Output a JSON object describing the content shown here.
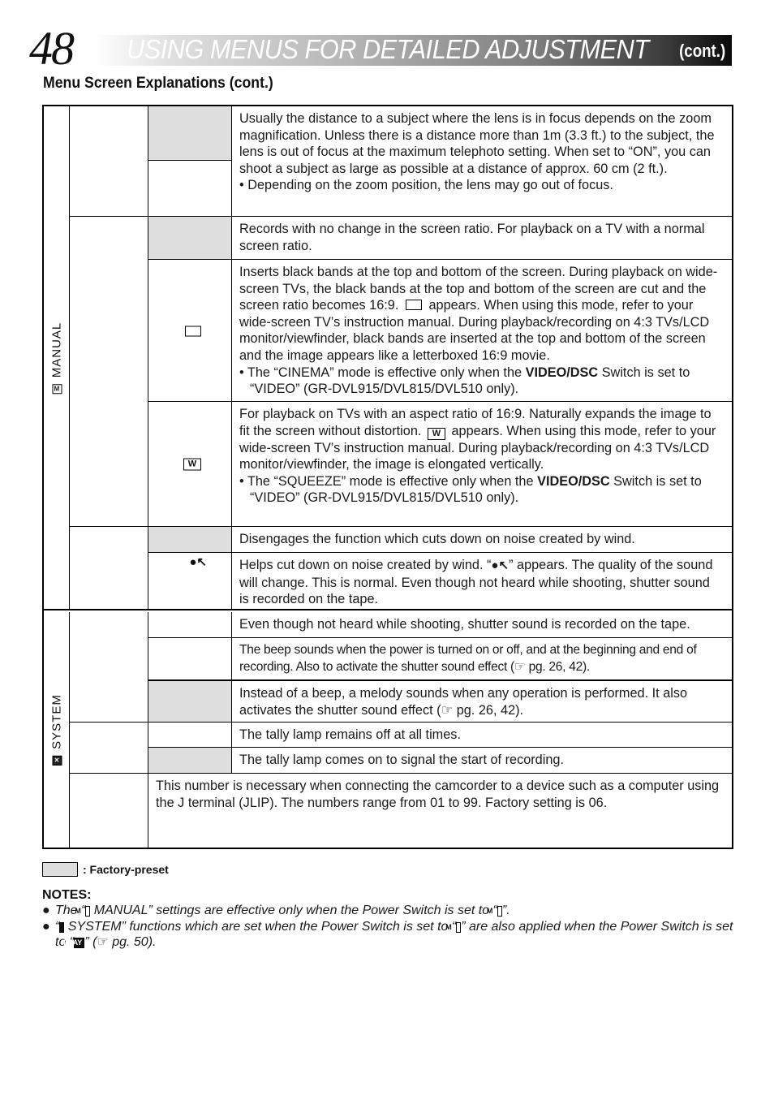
{
  "header": {
    "page_number": "48",
    "title": "USING MENUS FOR DETAILED ADJUSTMENT",
    "cont": "(cont.)"
  },
  "section_title": "Menu Screen Explanations (cont.)",
  "groups": {
    "manual": {
      "label": "MANUAL",
      "icon": "M",
      "rows": {
        "tele_macro": {
          "desc": "Usually the distance to a subject where the lens is in focus depends on the zoom magnification. Unless there is a distance more than 1m (3.3 ft.) to the subject, the lens is out of focus at the maximum telephoto setting. When set to “ON”, you can shoot a subject as large as possible at a distance of approx. 60 cm (2 ft.).",
          "bullet": "• Depending on the zoom position, the lens may go out of focus."
        },
        "wide_normal": {
          "desc": "Records with no change in the screen ratio. For playback on a TV with a normal screen ratio."
        },
        "wide_cinema": {
          "icon": "cinema-frame-icon",
          "desc_a": "Inserts black bands at the top and bottom of the screen. During playback on wide-screen TVs, the black bands at the top and bottom of the screen are cut and the screen ratio becomes 16:9.",
          "desc_b": "appears. When using this mode, refer to your wide-screen TV’s instruction manual. During playback/recording on 4:3 TVs/LCD monitor/viewfinder, black bands are inserted at the top and bottom of the screen and the image appears like a letterboxed 16:9 movie.",
          "bullet_a": "• The “CINEMA” mode is effective only when the ",
          "bullet_bold": "VIDEO/DSC",
          "bullet_b": " Switch is set to “VIDEO” (GR-DVL915/DVL815/DVL510 only)."
        },
        "wide_squeeze": {
          "icon_text": "W",
          "desc_a": "For playback on TVs with an aspect ratio of 16:9. Naturally expands the image to fit the screen without distortion.",
          "desc_b": "appears. When using this mode, refer to your wide-screen TV’s instruction manual. During playback/recording on 4:3 TVs/LCD monitor/viewfinder, the image is elongated vertically.",
          "bullet_a": "• The “SQUEEZE” mode is effective only when the ",
          "bullet_bold": "VIDEO/DSC",
          "bullet_b": " Switch is set to “VIDEO” (GR-DVL915/DVL815/DVL510 only)."
        },
        "wind_off": {
          "desc": "Disengages the function which cuts down on noise created by wind."
        },
        "wind_on": {
          "icon_glyph": "●↖",
          "desc_a": "Helps cut down on noise created by wind. “",
          "desc_b": "” appears. The quality of the sound will change. This is normal. Even though not heard while shooting, shutter sound is recorded on the tape."
        }
      }
    },
    "system": {
      "label": "SYSTEM",
      "icon": "✕",
      "rows": {
        "beep_off": {
          "desc": "Even though not heard while shooting, shutter sound is recorded on the tape."
        },
        "beep_beep": {
          "desc": "The beep sounds when the power is turned on or off, and at the beginning and end of recording. Also to activate the shutter sound effect (☞ pg. 26, 42)."
        },
        "beep_melody": {
          "desc": "Instead of a beep, a melody sounds when any operation is performed. It also activates the shutter sound effect (☞ pg. 26, 42)."
        },
        "tally_off": {
          "desc": "The tally lamp remains off at all times."
        },
        "tally_on": {
          "desc": "The tally lamp comes on to signal the start of recording."
        },
        "remote_number": {
          "desc": "This number is necessary when connecting the camcorder to a device such as a computer using the J terminal (JLIP). The numbers range from 01 to 99. Factory setting is 06."
        }
      }
    }
  },
  "legend": {
    "label": ": Factory-preset",
    "swatch_color": "#dedede"
  },
  "notes": {
    "title": "NOTES:",
    "note1_a": "The “",
    "note1_icon": "M",
    "note1_b": " MANUAL” settings are effective only when the Power Switch is set to “",
    "note1_switch": "M",
    "note1_c": "”.",
    "note2_a": "“",
    "note2_icon": "✕",
    "note2_b": " SYSTEM” functions which are set when the Power Switch is set to “",
    "note2_switch": "M",
    "note2_c": "” are also applied when the Power Switch is set to “",
    "note2_play": "PLAY",
    "note2_d": "” (",
    "note2_ref": "☞",
    "note2_e": " pg. 50)."
  }
}
